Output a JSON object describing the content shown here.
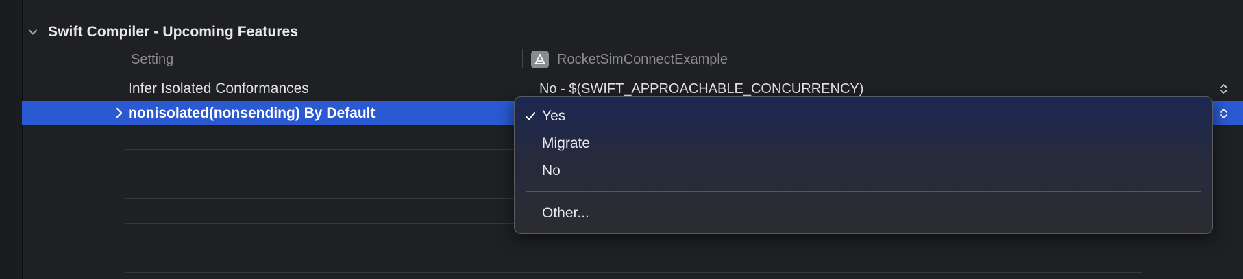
{
  "section": {
    "title": "Swift Compiler - Upcoming Features"
  },
  "columns": {
    "setting": "Setting",
    "target": "RocketSimConnectExample"
  },
  "rows": [
    {
      "label": "Infer Isolated Conformances",
      "value": "No  -  $(SWIFT_APPROACHABLE_CONCURRENCY)"
    },
    {
      "label": "nonisolated(nonsending) By Default",
      "value": "Yes"
    }
  ],
  "popup_menu": {
    "items": [
      {
        "label": "Yes",
        "checked": true
      },
      {
        "label": "Migrate",
        "checked": false
      },
      {
        "label": "No",
        "checked": false
      }
    ],
    "other": "Other..."
  },
  "colors": {
    "selection": "#2a59d2",
    "background": "#1f2023"
  },
  "icons": {
    "section_toggle": "chevron-down-icon",
    "row_disclosure": "chevron-right-icon",
    "target": "app-target-icon",
    "stepper": "up-down-stepper-icon",
    "checkmark": "checkmark-icon"
  }
}
